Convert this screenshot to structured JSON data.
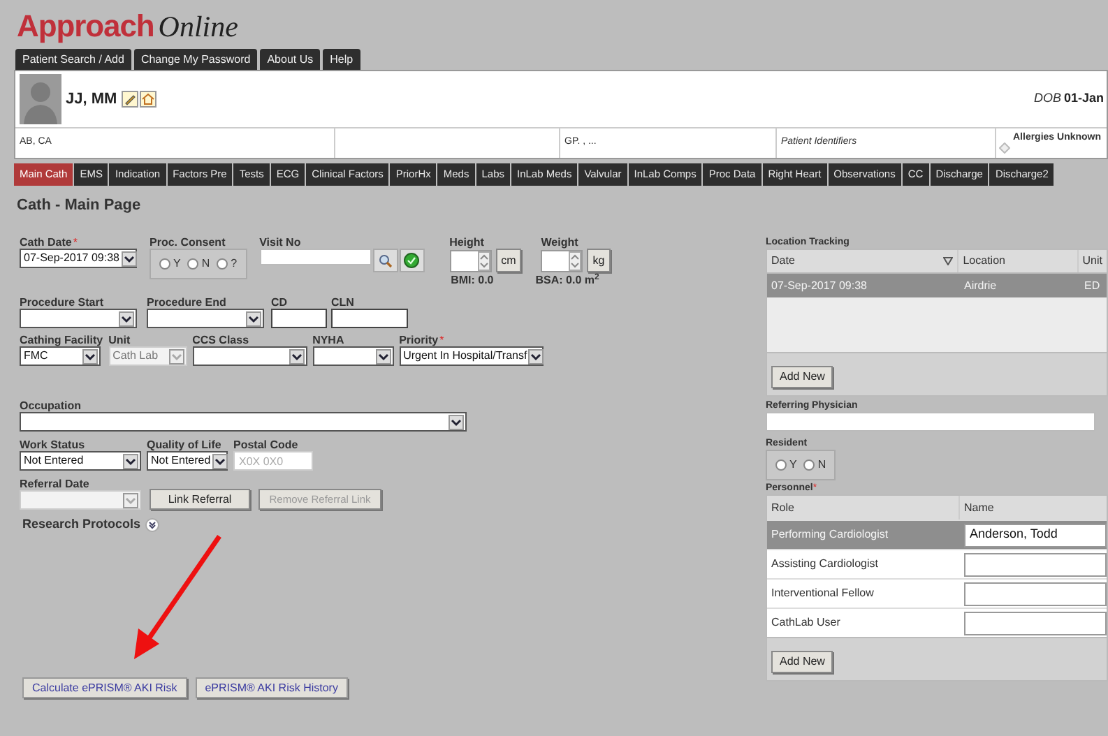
{
  "app": {
    "brand": "Approach",
    "product": "Online"
  },
  "top_tabs": [
    "Patient Search / Add",
    "Change My Password",
    "About Us",
    "Help"
  ],
  "patient": {
    "name": "JJ, MM",
    "dob_label": "DOB",
    "dob": "01-Jan",
    "location": "AB, CA",
    "gp": "GP. , ...",
    "identifiers": "Patient Identifiers",
    "allergies": "Allergies Unknown"
  },
  "module_tabs": [
    {
      "label": "Main Cath",
      "selected": true
    },
    {
      "label": "EMS",
      "selected": false
    },
    {
      "label": "Indication",
      "selected": false
    },
    {
      "label": "Factors Pre",
      "selected": false
    },
    {
      "label": "Tests",
      "selected": false
    },
    {
      "label": "ECG",
      "selected": false
    },
    {
      "label": "Clinical Factors",
      "selected": false
    },
    {
      "label": "PriorHx",
      "selected": false
    },
    {
      "label": "Meds",
      "selected": false
    },
    {
      "label": "Labs",
      "selected": false
    },
    {
      "label": "InLab Meds",
      "selected": false
    },
    {
      "label": "Valvular",
      "selected": false
    },
    {
      "label": "InLab Comps",
      "selected": false
    },
    {
      "label": "Proc Data",
      "selected": false
    },
    {
      "label": "Right Heart",
      "selected": false
    },
    {
      "label": "Observations",
      "selected": false
    },
    {
      "label": "CC",
      "selected": false
    },
    {
      "label": "Discharge",
      "selected": false
    },
    {
      "label": "Discharge2",
      "selected": false
    }
  ],
  "page_title": "Cath - Main Page",
  "form": {
    "cath_date": {
      "label": "Cath Date",
      "marker": "*",
      "value": "07-Sep-2017 09:38"
    },
    "proc_consent": {
      "label": "Proc. Consent",
      "options": [
        {
          "label": "Y",
          "selected": false
        },
        {
          "label": "N",
          "selected": false
        },
        {
          "label": "?",
          "selected": false
        }
      ]
    },
    "visit_no": {
      "label": "Visit No"
    },
    "height": {
      "label": "Height",
      "unit": "cm"
    },
    "weight": {
      "label": "Weight",
      "unit": "kg"
    },
    "bmi": "BMI: 0.0",
    "bsa": "BSA: 0.0 m$^{2}$",
    "procedure_start": {
      "label": "Procedure Start"
    },
    "procedure_end": {
      "label": "Procedure End"
    },
    "cd": {
      "label": "CD"
    },
    "cln": {
      "label": "CLN"
    },
    "cathing_facility": {
      "label": "Cathing Facility",
      "value": "FMC",
      "disabled": false
    },
    "unit": {
      "label": "Unit",
      "value": "Cath Lab",
      "disabled": true
    },
    "ccs_class": {
      "label": "CCS Class",
      "disabled": false
    },
    "nyha": {
      "label": "NYHA",
      "disabled": false
    },
    "priority": {
      "label": "Priority",
      "marker": "*",
      "value": "Urgent In Hospital/Transf",
      "disabled": false
    },
    "occupation": {
      "label": "Occupation",
      "disabled": false
    },
    "work_status": {
      "label": "Work Status",
      "value": "Not Entered",
      "disabled": false
    },
    "quality_of_life": {
      "label": "Quality of Life",
      "value": "Not Entered",
      "disabled": false
    },
    "postal_code": {
      "label": "Postal Code",
      "placeholder": "X0X 0X0"
    },
    "referral_date": {
      "label": "Referral Date",
      "disabled": true
    },
    "link_referral": {
      "label": "Link Referral",
      "disabled": false
    },
    "remove_referral": {
      "label": "Remove Referral Link",
      "disabled": true
    },
    "research_protocols": {
      "label": "Research Protocols",
      "expanded": false
    }
  },
  "location_tracking": {
    "title": "Location Tracking",
    "columns": [
      "Date",
      "Location",
      "Unit"
    ],
    "rows": [
      {
        "cells": [
          "07-Sep-2017 09:38",
          "Airdrie",
          "ED"
        ],
        "selected": true
      }
    ],
    "add_button": "Add New"
  },
  "referring_physician": {
    "label": "Referring Physician"
  },
  "resident": {
    "label": "Resident",
    "options": [
      {
        "label": "Y",
        "selected": false
      },
      {
        "label": "N",
        "selected": false
      }
    ]
  },
  "personnel": {
    "label": "Personnel",
    "marker": "*",
    "columns": [
      "Role",
      "Name"
    ],
    "rows": [
      {
        "role": "Performing Cardiologist",
        "name": "Anderson, Todd",
        "selected": true
      },
      {
        "role": "Assisting Cardiologist",
        "selected": false
      },
      {
        "role": "Interventional Fellow",
        "selected": false
      },
      {
        "role": "CathLab User",
        "selected": false
      }
    ],
    "add_button": "Add New"
  },
  "risk_buttons": [
    "Calculate ePRISM® AKI Risk",
    "ePRISM® AKI Risk History"
  ]
}
